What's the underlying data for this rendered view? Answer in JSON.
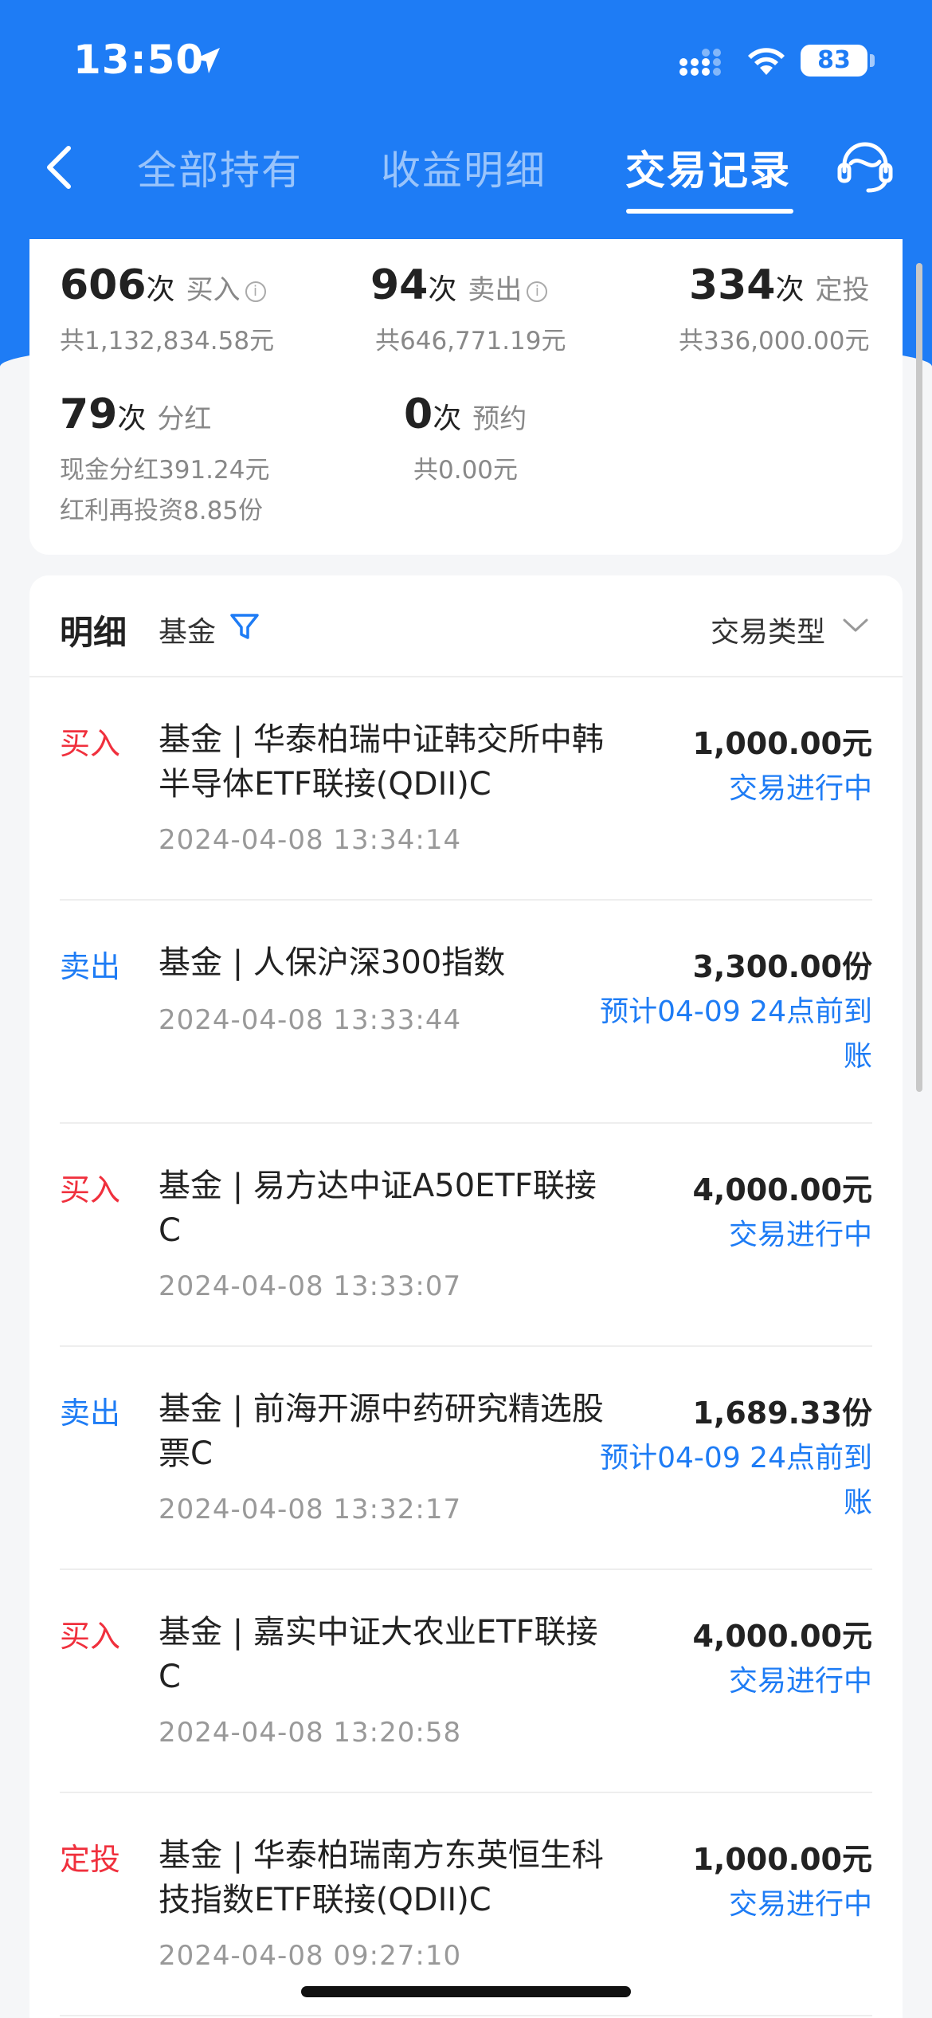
{
  "status_bar": {
    "time": "13:50",
    "battery": "83"
  },
  "nav": {
    "tabs": [
      {
        "label": "全部持有"
      },
      {
        "label": "收益明细"
      },
      {
        "label": "交易记录"
      }
    ],
    "active_tab": "交易记录"
  },
  "summary": {
    "buy": {
      "count": "606",
      "unit": "次",
      "label": "买入",
      "total": "共1,132,834.58元"
    },
    "sell": {
      "count": "94",
      "unit": "次",
      "label": "卖出",
      "total": "共646,771.19元"
    },
    "auto_invest": {
      "count": "334",
      "unit": "次",
      "label": "定投",
      "total": "共336,000.00元"
    },
    "dividend": {
      "count": "79",
      "unit": "次",
      "label": "分红",
      "cash": "现金分红391.24元",
      "reinvest": "红利再投资8.85份"
    },
    "reservation": {
      "count": "0",
      "unit": "次",
      "label": "预约",
      "total": "共0.00元"
    }
  },
  "detail": {
    "title": "明细",
    "filter_label": "基金",
    "type_label": "交易类型"
  },
  "transactions": [
    {
      "kind": "买入",
      "kind_color": "#f0303d",
      "name": "基金 | 华泰柏瑞中证韩交所中韩半导体ETF联接(QDII)C",
      "datetime": "2024-04-08 13:34:14",
      "amount": "1,000.00元",
      "status": "交易进行中"
    },
    {
      "kind": "卖出",
      "kind_color": "#1e7cf5",
      "name": "基金 | 人保沪深300指数",
      "datetime": "2024-04-08 13:33:44",
      "amount": "3,300.00份",
      "status": "预计04-09 24点前到账"
    },
    {
      "kind": "买入",
      "kind_color": "#f0303d",
      "name": "基金 | 易方达中证A50ETF联接C",
      "datetime": "2024-04-08 13:33:07",
      "amount": "4,000.00元",
      "status": "交易进行中"
    },
    {
      "kind": "卖出",
      "kind_color": "#1e7cf5",
      "name": "基金 | 前海开源中药研究精选股票C",
      "datetime": "2024-04-08 13:32:17",
      "amount": "1,689.33份",
      "status": "预计04-09 24点前到账"
    },
    {
      "kind": "买入",
      "kind_color": "#f0303d",
      "name": "基金 | 嘉实中证大农业ETF联接C",
      "datetime": "2024-04-08 13:20:58",
      "amount": "4,000.00元",
      "status": "交易进行中"
    },
    {
      "kind": "定投",
      "kind_color": "#f0303d",
      "name": "基金 | 华泰柏瑞南方东英恒生科技指数ETF联接(QDII)C",
      "datetime": "2024-04-08 09:27:10",
      "amount": "1,000.00元",
      "status": "交易进行中"
    }
  ]
}
